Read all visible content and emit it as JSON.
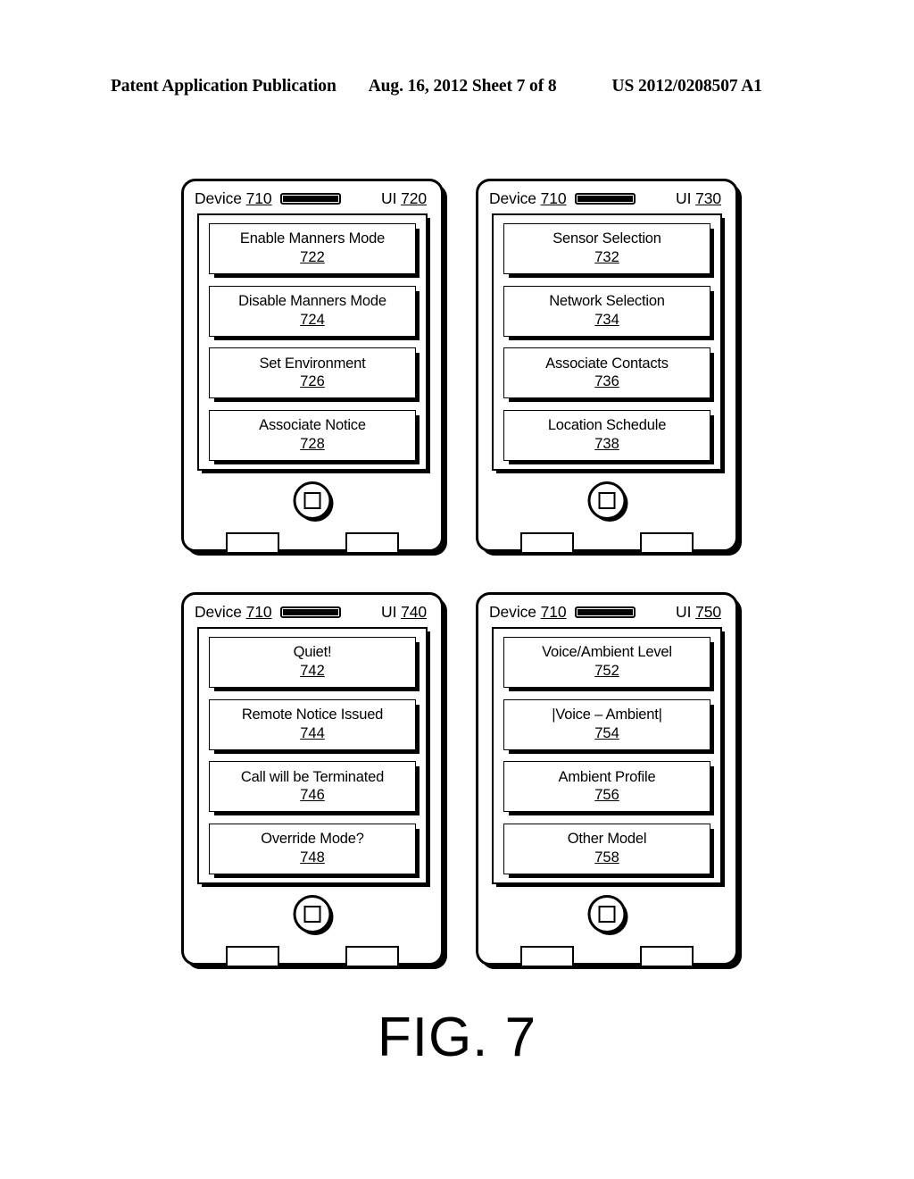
{
  "header": {
    "publication": "Patent Application Publication",
    "date_sheet": "Aug. 16, 2012  Sheet 7 of 8",
    "pub_number": "US 2012/0208507 A1"
  },
  "figure": {
    "caption": "FIG. 7"
  },
  "devices": [
    {
      "device_label": "Device ",
      "device_number": "710",
      "ui_label": "UI ",
      "ui_number": "720",
      "buttons": [
        {
          "label": "Enable Manners Mode",
          "number": "722"
        },
        {
          "label": "Disable Manners Mode",
          "number": "724"
        },
        {
          "label": "Set Environment",
          "number": "726"
        },
        {
          "label": "Associate Notice",
          "number": "728"
        }
      ]
    },
    {
      "device_label": "Device ",
      "device_number": "710",
      "ui_label": "UI ",
      "ui_number": "730",
      "buttons": [
        {
          "label": "Sensor Selection",
          "number": "732"
        },
        {
          "label": "Network Selection",
          "number": "734"
        },
        {
          "label": "Associate Contacts",
          "number": "736"
        },
        {
          "label": "Location Schedule",
          "number": "738"
        }
      ]
    },
    {
      "device_label": "Device ",
      "device_number": "710",
      "ui_label": "UI ",
      "ui_number": "740",
      "buttons": [
        {
          "label": "Quiet!",
          "number": "742"
        },
        {
          "label": "Remote Notice Issued",
          "number": "744"
        },
        {
          "label": "Call will be Terminated",
          "number": "746"
        },
        {
          "label": "Override Mode?",
          "number": "748"
        }
      ]
    },
    {
      "device_label": "Device ",
      "device_number": "710",
      "ui_label": "UI ",
      "ui_number": "750",
      "buttons": [
        {
          "label": "Voice/Ambient Level",
          "number": "752"
        },
        {
          "label": "|Voice – Ambient|",
          "number": "754"
        },
        {
          "label": "Ambient Profile",
          "number": "756"
        },
        {
          "label": "Other Model",
          "number": "758"
        }
      ]
    }
  ]
}
